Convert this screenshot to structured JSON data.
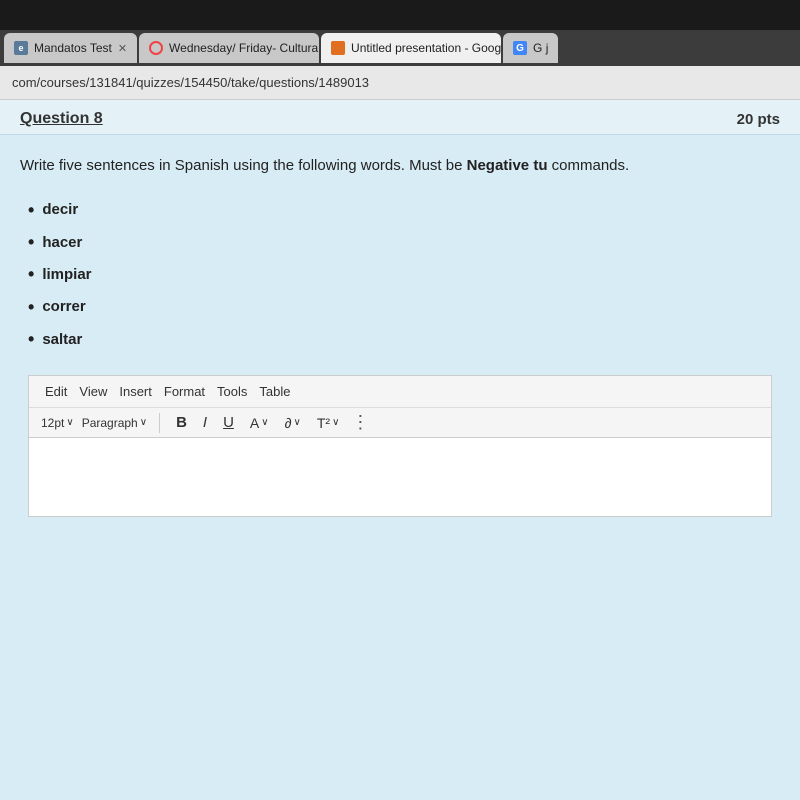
{
  "topBar": {},
  "tabs": [
    {
      "id": "tab1",
      "label": "Mandatos Test",
      "active": false,
      "faviconType": "text",
      "faviconText": "e"
    },
    {
      "id": "tab2",
      "label": "Wednesday/ Friday- Cultural De",
      "active": false,
      "faviconType": "circle-red"
    },
    {
      "id": "tab3",
      "label": "Untitled presentation - Google S",
      "active": false,
      "faviconType": "orange-rect"
    },
    {
      "id": "tab4",
      "label": "G j",
      "active": false,
      "faviconType": "g-blue"
    }
  ],
  "addressBar": {
    "url": "com/courses/131841/quizzes/154450/take/questions/1489013"
  },
  "question": {
    "title": "Question 8",
    "points": "20 pts",
    "text": "Write five sentences in Spanish using the following words. Must be Negative tu commands.",
    "textBold": "Negative tu",
    "words": [
      "decir",
      "hacer",
      "limpiar",
      "correr",
      "saltar"
    ]
  },
  "editor": {
    "menu": {
      "items": [
        "Edit",
        "View",
        "Insert",
        "Format",
        "Tools",
        "Table"
      ]
    },
    "formatBar": {
      "fontSize": "12pt",
      "fontSizeChevron": "∨",
      "paragraph": "Paragraph",
      "paragraphChevron": "∨",
      "boldLabel": "B",
      "italicLabel": "I",
      "underlineLabel": "U",
      "colorLabel": "A",
      "highlightLabel": "∂",
      "superLabel": "T²",
      "moreLabel": "⋮"
    }
  }
}
